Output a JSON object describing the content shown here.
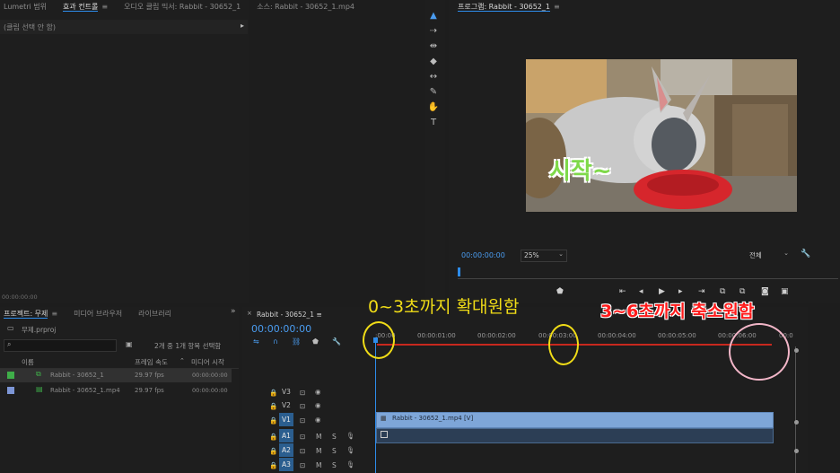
{
  "source_panel": {
    "tabs": [
      "Lumetri 범위",
      "효과 컨트롤",
      "오디오 클립 믹서: Rabbit - 30652_1",
      "소스: Rabbit - 30652_1.mp4"
    ],
    "menu_icon": "≡",
    "no_clip_text": "(클립 선택 안 함)",
    "timecode": "00:00:00:00"
  },
  "program_monitor": {
    "title": "프로그램: Rabbit - 30652_1",
    "timecode": "00:00:00:00",
    "zoom": "25%",
    "quality": "전체",
    "video_caption": "시작~"
  },
  "project_panel": {
    "tabs": [
      "프로젝트: 무제",
      "미디어 브라우저",
      "라이브러리"
    ],
    "file": "무제.prproj",
    "selection_info": "2개 중 1개 항목 선택함",
    "columns": [
      "이름",
      "프레임 속도",
      "미디어 시작"
    ],
    "rows": [
      {
        "name": "Rabbit - 30652_1",
        "fps": "29.97 fps",
        "start": "00:00:00:00",
        "color": "#3fae49"
      },
      {
        "name": "Rabbit - 30652_1.mp4",
        "fps": "29.97 fps",
        "start": "00:00:00:00",
        "color": "#7d96d6"
      }
    ]
  },
  "timeline": {
    "sequence_name": "Rabbit - 30652_1",
    "timecode": "00:00:00:00",
    "ruler": [
      ":00:00",
      "00:00:01:00",
      "00:00:02:00",
      "00:00:03:00",
      "00:00:04:00",
      "00:00:05:00",
      "00:00:06:00",
      "00:0"
    ],
    "video_tracks": [
      "V3",
      "V2",
      "V1"
    ],
    "audio_tracks": [
      "A1",
      "A2",
      "A3"
    ],
    "clip_label": "Rabbit - 30652_1.mp4 [V]"
  },
  "annotations": {
    "zoom_in": "0~3초까지 확대원함",
    "zoom_out": "3~6초까지 축소원함"
  },
  "colors": {
    "accent": "#2d8ceb",
    "video_clip": "#7ea6d8",
    "annotation_yellow": "#f0dc17",
    "annotation_red": "#ff1b1b"
  }
}
